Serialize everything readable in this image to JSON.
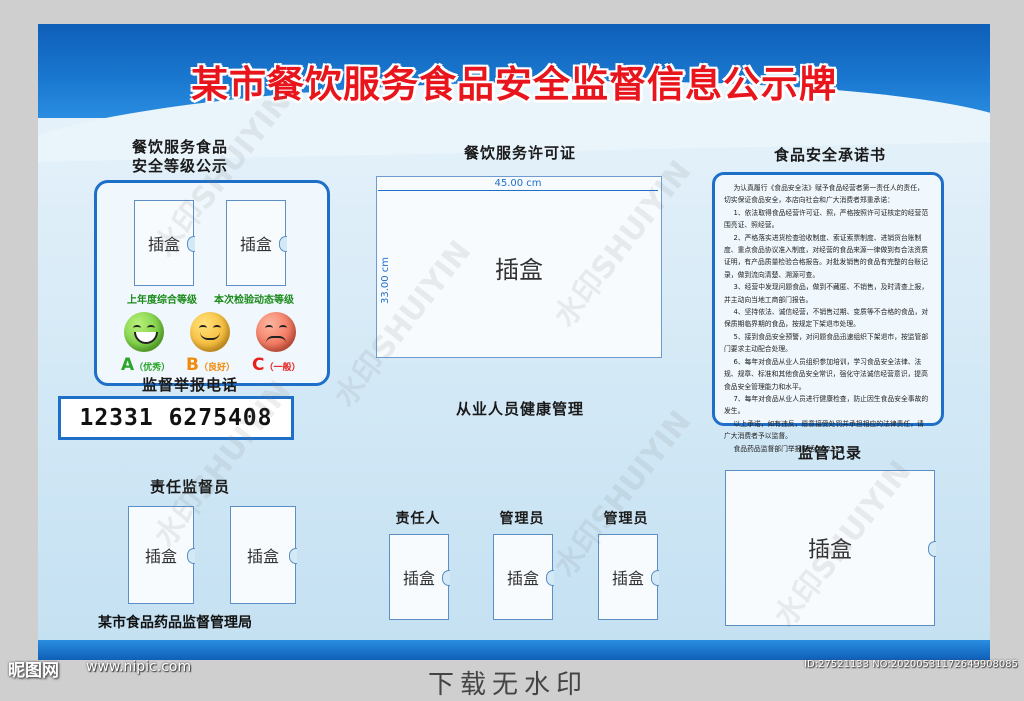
{
  "title": "某市餐饮服务食品安全监督信息公示牌",
  "grade_section": {
    "heading_line1": "餐饮服务食品",
    "heading_line2": "安全等级公示",
    "slot_left": "插盒",
    "slot_right": "插盒",
    "label_left": "上年度综合等级",
    "label_right": "本次检验动态等级",
    "grades": [
      {
        "letter": "A",
        "note": "（优秀）",
        "color": "#2aa52a",
        "face": "smile-face-icon"
      },
      {
        "letter": "B",
        "note": "（良好）",
        "color": "#f08a0a",
        "face": "neutral-face-icon"
      },
      {
        "letter": "C",
        "note": "（一般）",
        "color": "#e8201c",
        "face": "sad-face-icon"
      }
    ]
  },
  "phone_section": {
    "heading": "监督举报电话",
    "number": "12331  6275408"
  },
  "supervisor_section": {
    "heading": "责任监督员",
    "slot1": "插盒",
    "slot2": "插盒"
  },
  "authority": "某市食品药品监督管理局",
  "license_section": {
    "heading": "餐饮服务许可证",
    "width_label": "45.00 cm",
    "height_label": "33.00 cm",
    "slot": "插盒"
  },
  "health_section": {
    "heading": "从业人员健康管理",
    "roles": [
      {
        "label": "责任人",
        "slot": "插盒"
      },
      {
        "label": "管理员",
        "slot": "插盒"
      },
      {
        "label": "管理员",
        "slot": "插盒"
      }
    ]
  },
  "promise_section": {
    "heading": "食品安全承诺书",
    "paragraphs": [
      "为认真履行《食品安全法》赋予食品经营者第一责任人的责任，切实保证食品安全，本店向社会和广大消费者郑重承诺：",
      "1、依法取得食品经营许可证、照，严格按照许可证核定的经营范围亮证、照经营。",
      "2、严格落实进货检查验收制度、索证索票制度、进销货台账制度、重点食品协议准入制度，对经营的食品来源一律做到有合法资质证明，有产品质量检验合格报告。对批发销售的食品有完整的台账记录，做到流向清楚、溯源可查。",
      "3、经营中发现问题食品，做到不藏匿、不销售，及时清查上报，并主动向当地工商部门报告。",
      "4、坚持依法、诚信经营，不销售过期、变质等不合格的食品，对保质期临界期的食品，按规定下架退市处理。",
      "5、接到食品安全预警，对问题食品迅速组织下架退市，按监管部门要求主动配合处理。",
      "6、每年对食品从业人员组织参加培训，学习食品安全法律、法规、规章、标准和其他食品安全常识，强化守法诚信经营意识，提高食品安全管理能力和水平。",
      "7、每年对食品从业人员进行健康检查，防止因生食品安全事故的发生。",
      "以上承诺，如有违反，愿意接受处罚并承担相应的法律责任，请广大消费者予以监督。"
    ],
    "hotline": "食品药品监督部门举报电话：12331"
  },
  "record_section": {
    "heading": "监管记录",
    "slot": "插盒"
  },
  "watermark": "水印SHUIYIN",
  "site": {
    "logo": "昵图网",
    "url": "www.nipic.com",
    "id_text": "ID:27521133 NO:20200531172649908085",
    "banner": "下载无水印"
  },
  "colors": {
    "title_red": "#e8161c",
    "panel_blue": "#1e6fc8",
    "header_blue": "#1a78d0"
  }
}
